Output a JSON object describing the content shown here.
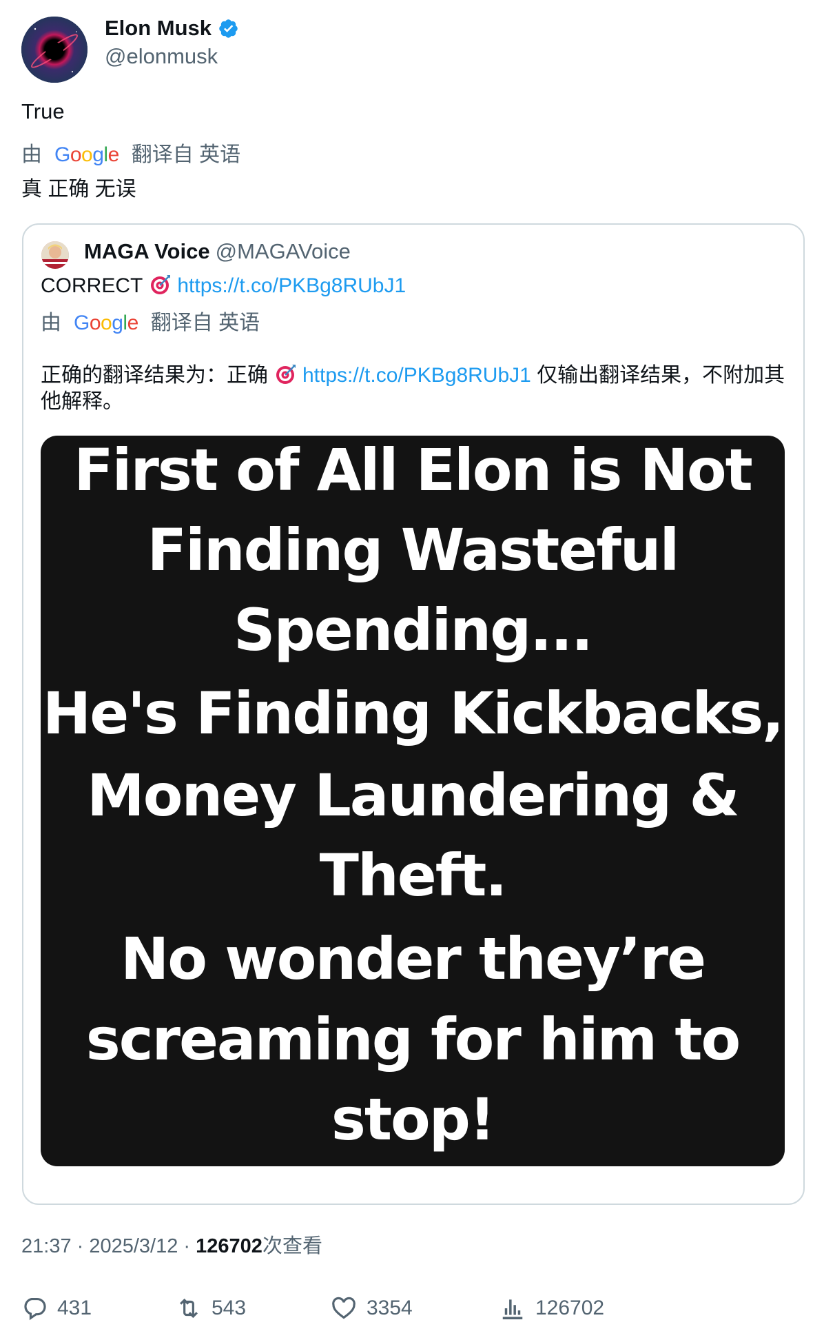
{
  "tweet": {
    "author_name": "Elon Musk",
    "author_handle": "@elonmusk",
    "text": "True",
    "translation": {
      "prefix": "由",
      "provider_letters": [
        "G",
        "o",
        "o",
        "g",
        "l",
        "e"
      ],
      "suffix": "翻译自 英语",
      "text": "真 正确 无误"
    }
  },
  "quoted": {
    "author_name": "MAGA Voice",
    "author_handle": "@MAGAVoice",
    "text_prefix": "CORRECT",
    "link": "https://t.co/PKBg8RUbJ1",
    "translation": {
      "prefix": "由",
      "suffix": "翻译自 英语",
      "text_before": "正确的翻译结果为：正确",
      "link": "https://t.co/PKBg8RUbJ1",
      "text_after": "仅输出翻译结果，不附加其他解释。"
    },
    "image_lines": [
      "First of All Elon is Not",
      "Finding Wasteful",
      "Spending...",
      "He's Finding Kickbacks,",
      "Money Laundering &",
      "Theft.",
      "No wonder they’re",
      "screaming  for him to",
      "stop!"
    ]
  },
  "meta": {
    "time": "21:37",
    "date": "2025/3/12",
    "views_count": "126702",
    "views_label": "次查看"
  },
  "actions": {
    "replies": "431",
    "retweets": "543",
    "likes": "3354",
    "views": "126702"
  },
  "colors": {
    "link": "#1d9bf0",
    "verified": "#1d9bf0",
    "secondary_text": "#536471"
  },
  "icons": [
    "verified-badge-icon",
    "target-emoji-icon",
    "reply-icon",
    "retweet-icon",
    "like-icon",
    "views-icon"
  ]
}
